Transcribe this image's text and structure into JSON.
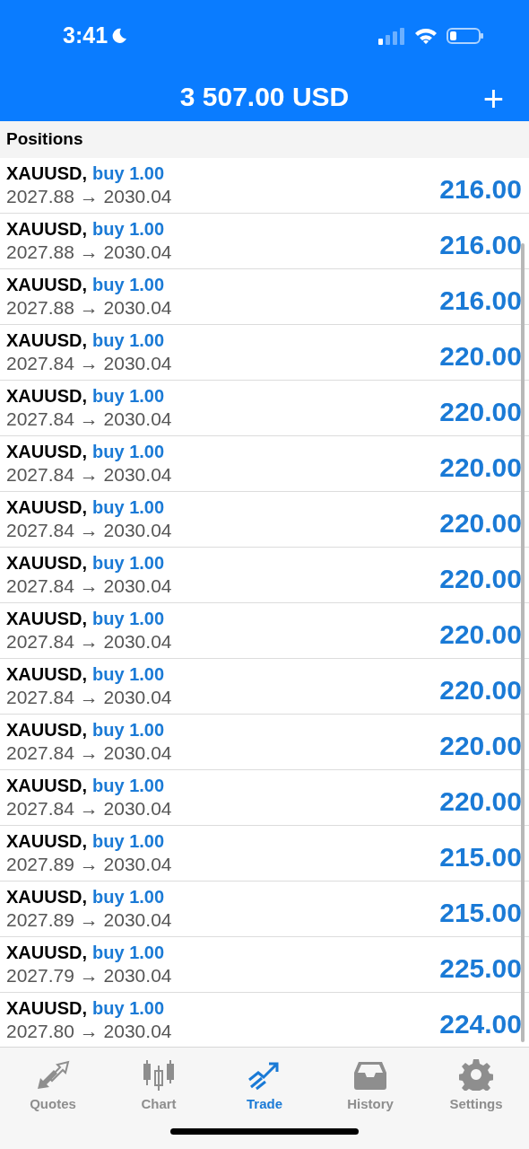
{
  "status_bar": {
    "time": "3:41"
  },
  "header": {
    "title": "3 507.00 USD",
    "add_button": "+"
  },
  "section": {
    "title": "Positions"
  },
  "positions": [
    {
      "symbol": "XAUUSD,",
      "order": "buy 1.00",
      "prices": "2027.88 → 2030.04",
      "profit": "216.00"
    },
    {
      "symbol": "XAUUSD,",
      "order": "buy 1.00",
      "prices": "2027.88 → 2030.04",
      "profit": "216.00"
    },
    {
      "symbol": "XAUUSD,",
      "order": "buy 1.00",
      "prices": "2027.88 → 2030.04",
      "profit": "216.00"
    },
    {
      "symbol": "XAUUSD,",
      "order": "buy 1.00",
      "prices": "2027.84 → 2030.04",
      "profit": "220.00"
    },
    {
      "symbol": "XAUUSD,",
      "order": "buy 1.00",
      "prices": "2027.84 → 2030.04",
      "profit": "220.00"
    },
    {
      "symbol": "XAUUSD,",
      "order": "buy 1.00",
      "prices": "2027.84 → 2030.04",
      "profit": "220.00"
    },
    {
      "symbol": "XAUUSD,",
      "order": "buy 1.00",
      "prices": "2027.84 → 2030.04",
      "profit": "220.00"
    },
    {
      "symbol": "XAUUSD,",
      "order": "buy 1.00",
      "prices": "2027.84 → 2030.04",
      "profit": "220.00"
    },
    {
      "symbol": "XAUUSD,",
      "order": "buy 1.00",
      "prices": "2027.84 → 2030.04",
      "profit": "220.00"
    },
    {
      "symbol": "XAUUSD,",
      "order": "buy 1.00",
      "prices": "2027.84 → 2030.04",
      "profit": "220.00"
    },
    {
      "symbol": "XAUUSD,",
      "order": "buy 1.00",
      "prices": "2027.84 → 2030.04",
      "profit": "220.00"
    },
    {
      "symbol": "XAUUSD,",
      "order": "buy 1.00",
      "prices": "2027.84 → 2030.04",
      "profit": "220.00"
    },
    {
      "symbol": "XAUUSD,",
      "order": "buy 1.00",
      "prices": "2027.89 → 2030.04",
      "profit": "215.00"
    },
    {
      "symbol": "XAUUSD,",
      "order": "buy 1.00",
      "prices": "2027.89 → 2030.04",
      "profit": "215.00"
    },
    {
      "symbol": "XAUUSD,",
      "order": "buy 1.00",
      "prices": "2027.79 → 2030.04",
      "profit": "225.00"
    },
    {
      "symbol": "XAUUSD,",
      "order": "buy 1.00",
      "prices": "2027.80 → 2030.04",
      "profit": "224.00"
    }
  ],
  "tabs": [
    {
      "label": "Quotes",
      "selected": false
    },
    {
      "label": "Chart",
      "selected": false
    },
    {
      "label": "Trade",
      "selected": true
    },
    {
      "label": "History",
      "selected": false
    },
    {
      "label": "Settings",
      "selected": false
    }
  ]
}
